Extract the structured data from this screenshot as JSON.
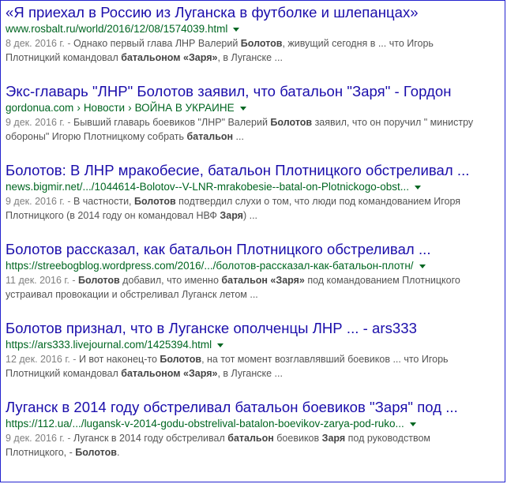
{
  "results": [
    {
      "title": "«Я приехал в Россию из Луганска в футболке и шлепанцах»",
      "url": "www.rosbalt.ru/world/2016/12/08/1574039.html",
      "date": "8 дек. 2016 г. - ",
      "snippet_parts": [
        {
          "t": "Однако первый глава ЛНР Валерий ",
          "b": false
        },
        {
          "t": "Болотов",
          "b": true
        },
        {
          "t": ", живущий сегодня в ... что Игорь Плотницкий командовал ",
          "b": false
        },
        {
          "t": "батальоном «Заря»",
          "b": true
        },
        {
          "t": ", в Луганске ...",
          "b": false
        }
      ]
    },
    {
      "title": "Экс-главарь \"ЛНР\" Болотов заявил, что батальон \"Заря\" - Гордон",
      "url": "gordonua.com",
      "crumbs": [
        "Новости",
        "ВОЙНА В УКРАИНЕ"
      ],
      "date": "9 дек. 2016 г. - ",
      "snippet_parts": [
        {
          "t": "Бывший главарь боевиков \"ЛНР\" Валерий ",
          "b": false
        },
        {
          "t": "Болотов",
          "b": true
        },
        {
          "t": " заявил, что он поручил \" министру обороны\" Игорю Плотницкому собрать ",
          "b": false
        },
        {
          "t": "батальон",
          "b": true
        },
        {
          "t": " ...",
          "b": false
        }
      ]
    },
    {
      "title": "Болотов: В ЛНР мракобесие, батальон Плотницкого обстреливал ...",
      "url": "news.bigmir.net/.../1044614-Bolotov--V-LNR-mrakobesie--batal-on-Plotnickogo-obst...",
      "date": "9 дек. 2016 г. - ",
      "snippet_parts": [
        {
          "t": "В частности, ",
          "b": false
        },
        {
          "t": "Болотов",
          "b": true
        },
        {
          "t": " подтвердил слухи о том, что люди под командованием Игоря Плотницкого (в 2014 году он командовал НВФ ",
          "b": false
        },
        {
          "t": "Заря",
          "b": true
        },
        {
          "t": ") ...",
          "b": false
        }
      ]
    },
    {
      "title": "Болотов рассказал, как батальон Плотницкого обстреливал ...",
      "url": "https://streebogblog.wordpress.com/2016/.../болотов-рассказал-как-батальон-плотн/",
      "date": "11 дек. 2016 г. - ",
      "snippet_parts": [
        {
          "t": "Болотов",
          "b": true
        },
        {
          "t": " добавил, что именно ",
          "b": false
        },
        {
          "t": "батальон «Заря»",
          "b": true
        },
        {
          "t": " под командованием Плотницкого устраивал провокации и обстреливал Луганск летом ...",
          "b": false
        }
      ]
    },
    {
      "title": "Болотов признал, что в Луганске ополченцы ЛНР ... - ars333",
      "url": "https://ars333.livejournal.com/1425394.html",
      "date": "12 дек. 2016 г. - ",
      "snippet_parts": [
        {
          "t": "И вот наконец-то ",
          "b": false
        },
        {
          "t": "Болотов",
          "b": true
        },
        {
          "t": ", на тот момент возглавлявший боевиков ... что Игорь Плотницкий командовал ",
          "b": false
        },
        {
          "t": "батальоном «Заря»",
          "b": true
        },
        {
          "t": ", в Луганске ...",
          "b": false
        }
      ]
    },
    {
      "title": "Луганск в 2014 году обстреливал батальон боевиков \"Заря\" под ...",
      "url": "https://112.ua/.../lugansk-v-2014-godu-obstrelival-batalon-boevikov-zarya-pod-ruko...",
      "date": "9 дек. 2016 г. - ",
      "snippet_parts": [
        {
          "t": "Луганск в 2014 году обстреливал ",
          "b": false
        },
        {
          "t": "батальон",
          "b": true
        },
        {
          "t": " боевиков ",
          "b": false
        },
        {
          "t": "Заря",
          "b": true
        },
        {
          "t": " под руководством Плотницкого, - ",
          "b": false
        },
        {
          "t": "Болотов",
          "b": true
        },
        {
          "t": ".",
          "b": false
        }
      ]
    }
  ],
  "colors": {
    "title_link": "#1a0dab",
    "url_green": "#006621",
    "snippet_text": "#545454",
    "date_gray": "#808080",
    "frame_border": "#2323d0"
  },
  "icons": {
    "url_menu": "dropdown-caret-icon"
  }
}
